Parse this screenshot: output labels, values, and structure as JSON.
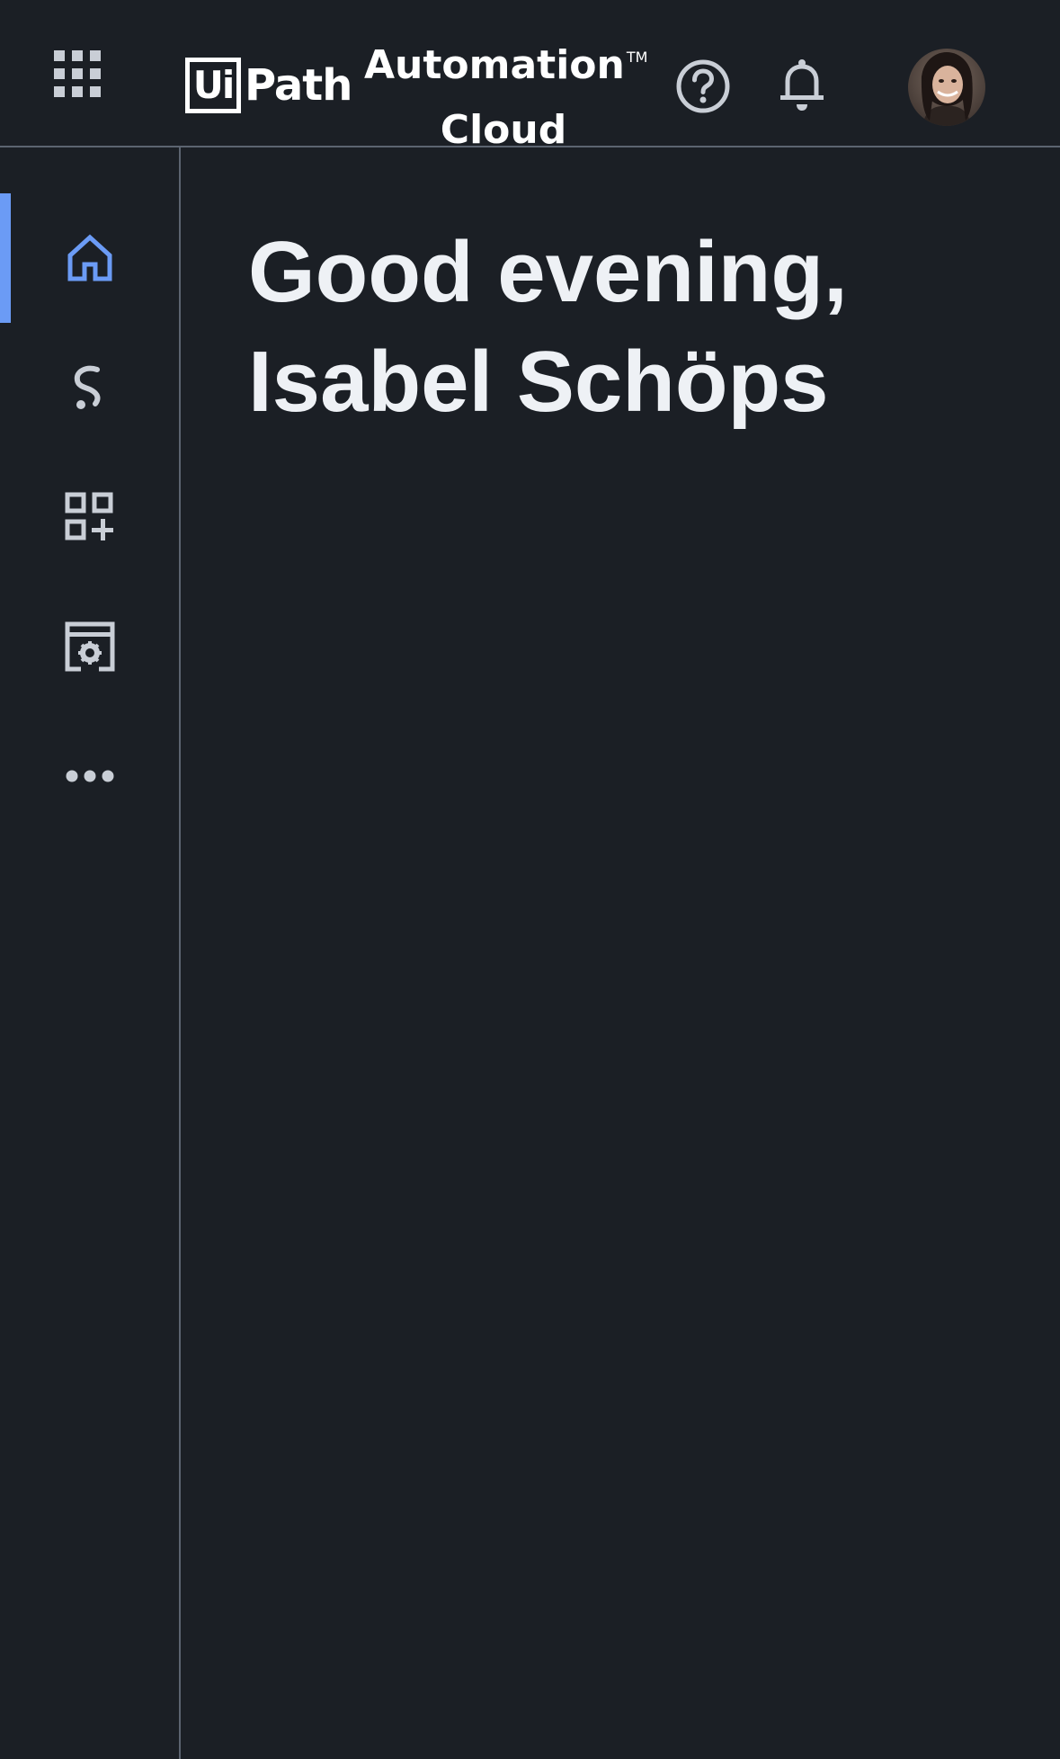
{
  "header": {
    "logo_box_text": "Ui",
    "logo_word": "Path",
    "product_line1": "Automation",
    "product_tm": "TM",
    "product_line2": "Cloud"
  },
  "icons": {
    "apps": "apps-grid-icon",
    "help": "help-circle-icon",
    "notifications": "bell-icon",
    "avatar": "user-avatar"
  },
  "sidebar": {
    "items": [
      {
        "icon": "home-icon",
        "active": true
      },
      {
        "icon": "automations-icon",
        "active": false
      },
      {
        "icon": "add-apps-icon",
        "active": false
      },
      {
        "icon": "admin-settings-icon",
        "active": false
      },
      {
        "icon": "more-icon",
        "active": false
      }
    ]
  },
  "main": {
    "greeting_line1": "Good evening,",
    "greeting_line2": "Isabel Schöps"
  },
  "colors": {
    "background": "#1b1f25",
    "accent": "#6b9bf5",
    "icon": "#c9ced6",
    "divider": "#5c6470",
    "text": "#eef1f5"
  }
}
